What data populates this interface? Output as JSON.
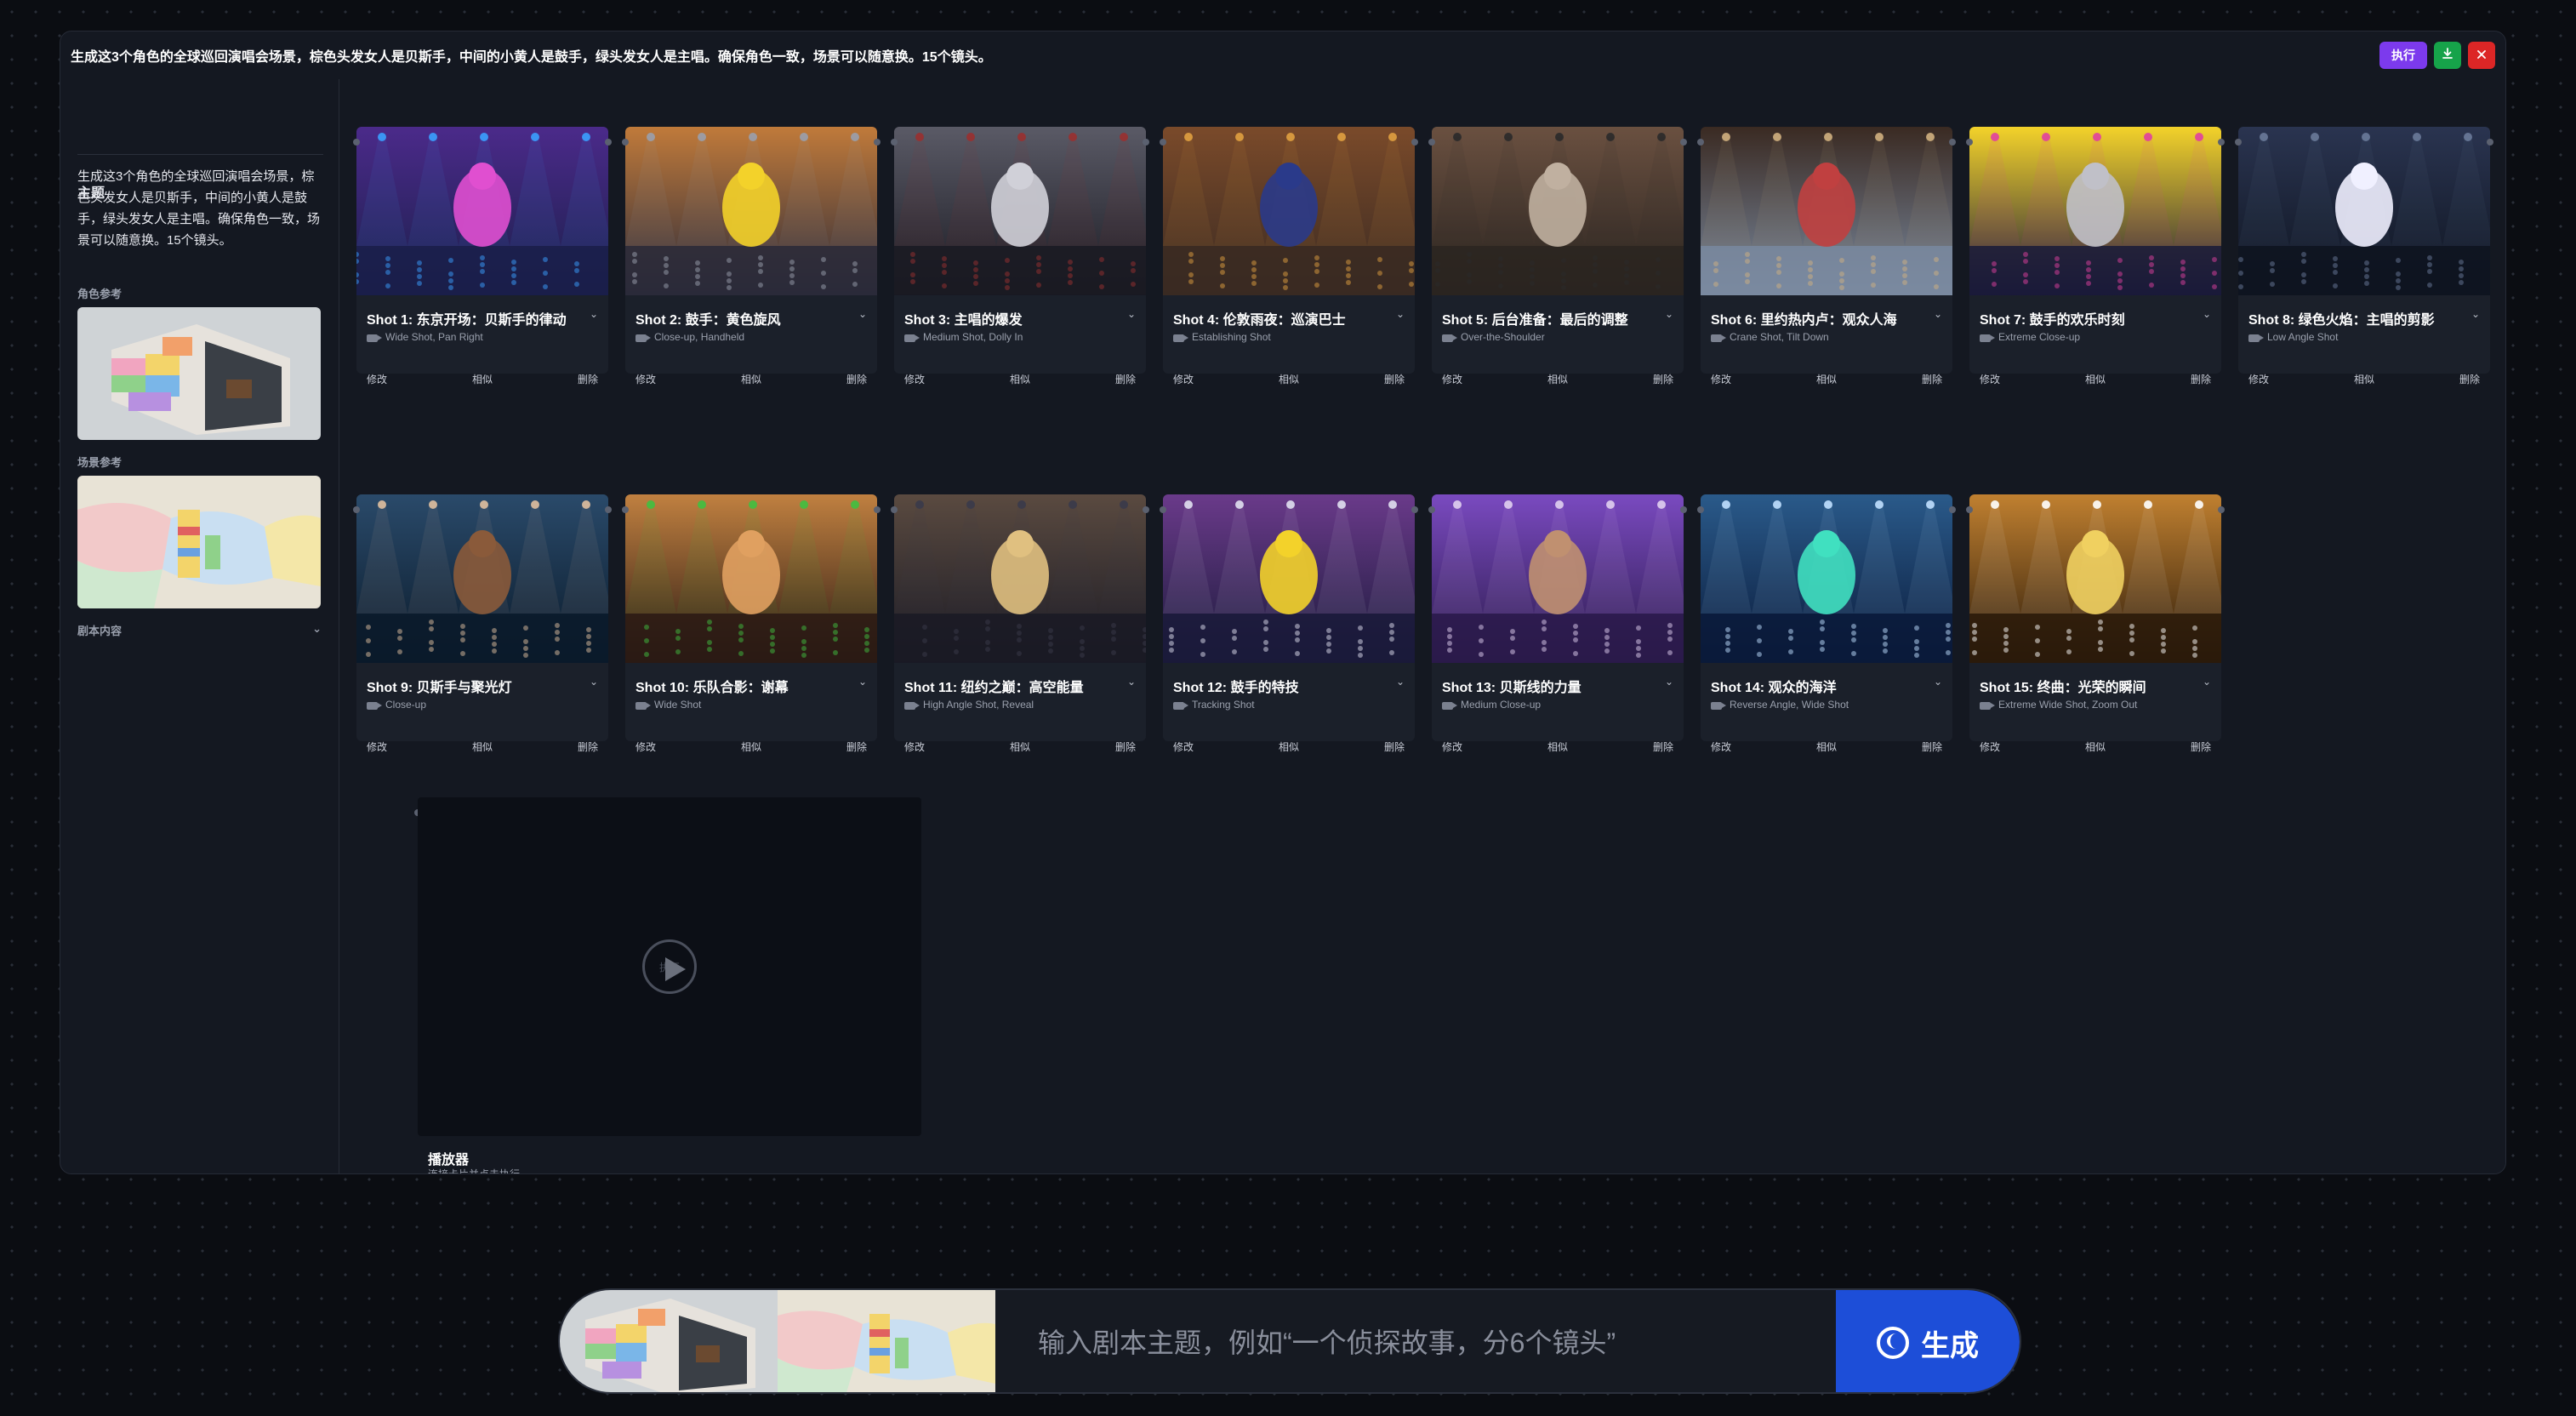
{
  "header": {
    "title": "生成这3个角色的全球巡回演唱会场景，棕色头发女人是贝斯手，中间的小黄人是鼓手，绿头发女人是主唱。确保角色一致，场景可以随意换。15个镜头。",
    "exec_label": "执行",
    "download_icon": "download-icon",
    "close_icon": "close-icon"
  },
  "sidebar": {
    "topic_heading": "主题",
    "topic_text": "生成这3个角色的全球巡回演唱会场景，棕色头发女人是贝斯手，中间的小黄人是鼓手，绿头发女人是主唱。确保角色一致，场景可以随意换。15个镜头。",
    "character_ref_label": "角色参考",
    "scene_ref_label": "场景参考",
    "script_label": "剧本内容"
  },
  "card_actions": {
    "edit": "修改",
    "similar": "相似",
    "delete": "删除"
  },
  "shots": [
    {
      "title": "Shot 1: 东京开场：贝斯手的律动",
      "shot": "Wide Shot, Pan Right"
    },
    {
      "title": "Shot 2: 鼓手：黄色旋风",
      "shot": "Close-up, Handheld"
    },
    {
      "title": "Shot 3: 主唱的爆发",
      "shot": "Medium Shot, Dolly In"
    },
    {
      "title": "Shot 4: 伦敦雨夜：巡演巴士",
      "shot": "Establishing Shot"
    },
    {
      "title": "Shot 5: 后台准备：最后的调整",
      "shot": "Over-the-Shoulder"
    },
    {
      "title": "Shot 6: 里约热内卢：观众人海",
      "shot": "Crane Shot, Tilt Down"
    },
    {
      "title": "Shot 7: 鼓手的欢乐时刻",
      "shot": "Extreme Close-up"
    },
    {
      "title": "Shot 8: 绿色火焰：主唱的剪影",
      "shot": "Low Angle Shot"
    },
    {
      "title": "Shot 9: 贝斯手与聚光灯",
      "shot": "Close-up"
    },
    {
      "title": "Shot 10: 乐队合影：谢幕",
      "shot": "Wide Shot"
    },
    {
      "title": "Shot 11: 纽约之巅：高空能量",
      "shot": "High Angle Shot, Reveal"
    },
    {
      "title": "Shot 12: 鼓手的特技",
      "shot": "Tracking Shot"
    },
    {
      "title": "Shot 13: 贝斯线的力量",
      "shot": "Medium Close-up"
    },
    {
      "title": "Shot 14: 观众的海洋",
      "shot": "Reverse Angle, Wide Shot"
    },
    {
      "title": "Shot 15: 终曲：光荣的瞬间",
      "shot": "Extreme Wide Shot, Zoom Out"
    }
  ],
  "player": {
    "title": "播放器",
    "subtitle": "连接卡片并点击执行",
    "play_label": "执行"
  },
  "generator": {
    "placeholder": "输入剧本主题，例如“一个侦探故事，分6个镜头”",
    "button_label": "生成"
  },
  "colors": {
    "background": "#0b0d12",
    "panel": "#141821",
    "card": "#1b202a",
    "exec": "#7c3aed",
    "download": "#16a34a",
    "close": "#dc2626",
    "generate": "#1d4ed8"
  }
}
